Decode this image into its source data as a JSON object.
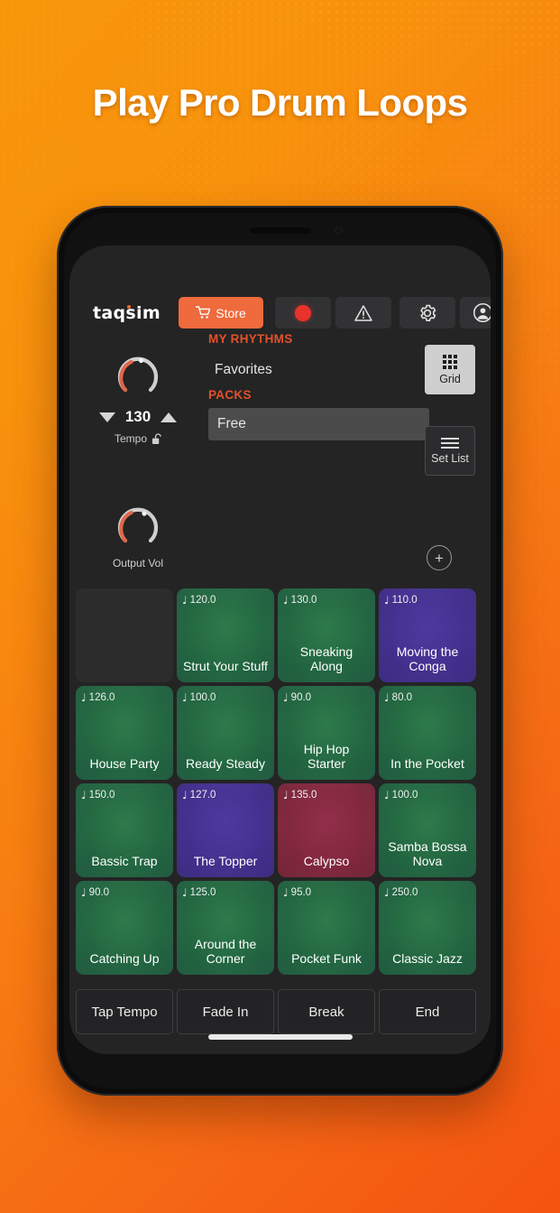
{
  "promo": {
    "headline": "Play Pro Drum Loops"
  },
  "app": {
    "toolbar": {
      "logo": "taqsim",
      "store_label": "Store",
      "cart_icon": "cart-icon",
      "record_icon": "record-icon",
      "warning_icon": "warning-triangle-icon",
      "settings_icon": "gear-icon",
      "account_icon": "account-circle-icon"
    },
    "tempo": {
      "value": "130",
      "label": "Tempo",
      "lock_icon": "unlocked-padlock-icon",
      "down_icon": "triangle-down-icon",
      "up_icon": "triangle-up-icon"
    },
    "output": {
      "label": "Output Vol"
    },
    "selector": {
      "my_rhythms_label": "MY RHYTHMS",
      "favorites_label": "Favorites",
      "packs_label": "PACKS",
      "pack_selected": "Free"
    },
    "view_buttons": {
      "grid_label": "Grid",
      "grid_icon": "grid-3x3-icon",
      "setlist_label": "Set List",
      "setlist_icon": "hamburger-lines-icon",
      "add_icon": "plus-circle-icon"
    },
    "pads": [
      {
        "name": "",
        "bpm": "",
        "color": "empty"
      },
      {
        "name": "Strut Your Stuff",
        "bpm": "120.0",
        "color": "green"
      },
      {
        "name": "Sneaking Along",
        "bpm": "130.0",
        "color": "green"
      },
      {
        "name": "Moving the Conga",
        "bpm": "110.0",
        "color": "purple"
      },
      {
        "name": "House Party",
        "bpm": "126.0",
        "color": "green"
      },
      {
        "name": "Ready Steady",
        "bpm": "100.0",
        "color": "green"
      },
      {
        "name": "Hip Hop Starter",
        "bpm": "90.0",
        "color": "green"
      },
      {
        "name": "In the Pocket",
        "bpm": "80.0",
        "color": "green"
      },
      {
        "name": "Bassic Trap",
        "bpm": "150.0",
        "color": "green"
      },
      {
        "name": "The Topper",
        "bpm": "127.0",
        "color": "purple"
      },
      {
        "name": "Calypso",
        "bpm": "135.0",
        "color": "crimson"
      },
      {
        "name": "Samba Bossa Nova",
        "bpm": "100.0",
        "color": "green"
      },
      {
        "name": "Catching Up",
        "bpm": "90.0",
        "color": "green"
      },
      {
        "name": "Around the Corner",
        "bpm": "125.0",
        "color": "green"
      },
      {
        "name": "Pocket Funk",
        "bpm": "95.0",
        "color": "green"
      },
      {
        "name": "Classic Jazz",
        "bpm": "250.0",
        "color": "green"
      }
    ],
    "transport": [
      {
        "label": "Tap Tempo"
      },
      {
        "label": "Fade In"
      },
      {
        "label": "Break"
      },
      {
        "label": "End"
      }
    ]
  },
  "colors": {
    "brand_orange": "#ef6a3d",
    "accent_red": "#e2512a",
    "record_red": "#e8332c",
    "pad_green": "#256b43",
    "pad_purple": "#453292",
    "pad_crimson": "#85293f",
    "bg_orange_top": "#f9960a",
    "bg_orange_bottom": "#f4530f"
  }
}
